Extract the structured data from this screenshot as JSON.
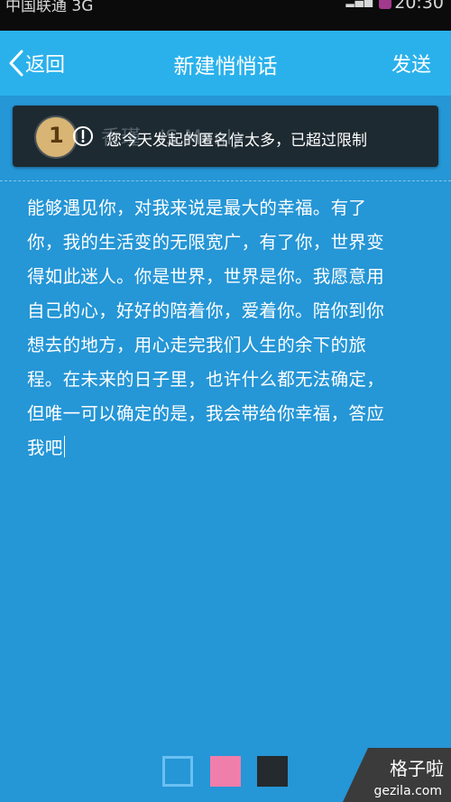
{
  "status_bar": {
    "carrier": "中国联通 3G",
    "time": "20:30"
  },
  "title_bar": {
    "back_label": "返回",
    "title": "新建悄悄话",
    "send_label": "发送"
  },
  "toast": {
    "message": "您今天发起的匿名信太多，已超过限制",
    "background_text": "香瑾 · IS Manly"
  },
  "message": {
    "lines": [
      "能够遇见你，对我来说是最大的幸福。有了",
      "你，我的生活变的无限宽广，有了你，世界变",
      "得如此迷人。你是世界，世界是你。我愿意用",
      "自己的心，好好的陪着你，爱着你。陪你到你",
      "想去的地方，用心走完我们人生的余下的旅",
      "程。在未来的日子里，也许什么都无法确定，",
      "但唯一可以确定的是，我会带给你幸福，答应",
      "我吧"
    ]
  },
  "color_options": [
    {
      "name": "blue",
      "color": "#2596d6",
      "selected": true
    },
    {
      "name": "pink",
      "color": "#f07eaa",
      "selected": false
    },
    {
      "name": "dark",
      "color": "#242a2e",
      "selected": false
    }
  ],
  "watermark": {
    "title": "格子啦",
    "domain": "gezila.com"
  },
  "colors": {
    "title_bar": "#2ab1eb",
    "background": "#2596d6",
    "toast": "#1e2a31"
  }
}
